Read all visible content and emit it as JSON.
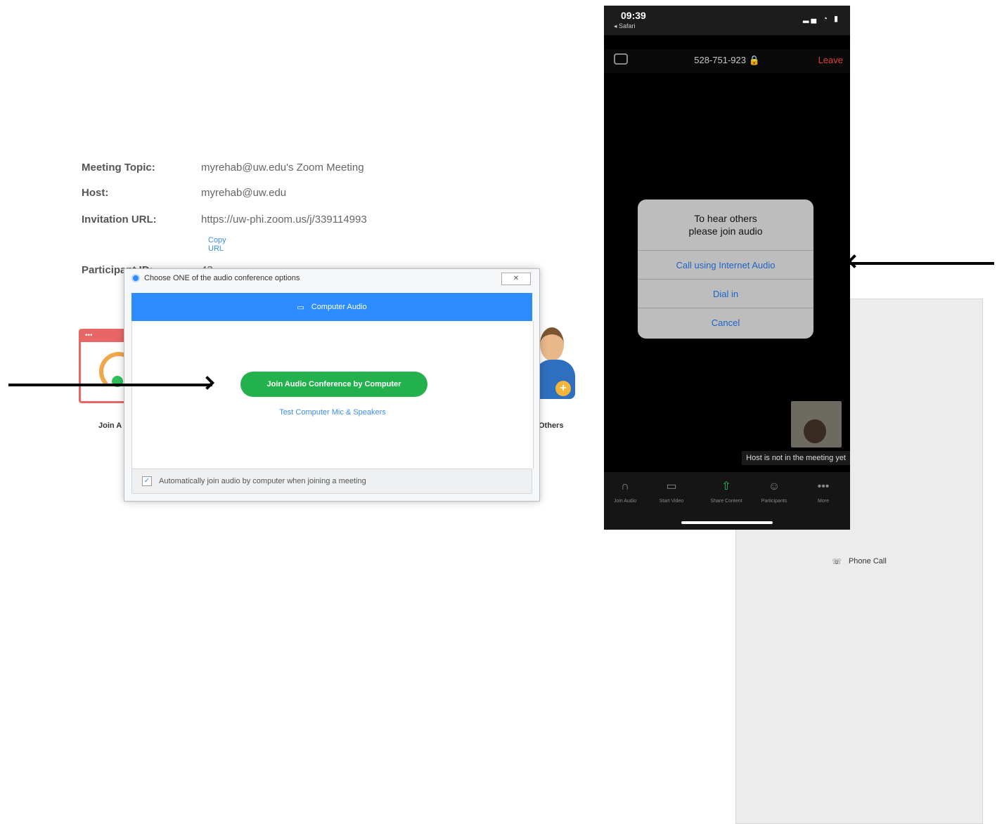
{
  "meeting_info": {
    "rows": [
      {
        "label": "Meeting Topic:",
        "value": "myrehab@uw.edu's Zoom Meeting"
      },
      {
        "label": "Host:",
        "value": "myrehab@uw.edu"
      },
      {
        "label": "Invitation URL:",
        "value": "https://uw-phi.zoom.us/j/339114993"
      }
    ],
    "copy_url": "Copy URL",
    "participant_label": "Participant ID:",
    "participant_value": "43"
  },
  "side_labels": {
    "left": "Join A",
    "right": "Others"
  },
  "desktop_dialog": {
    "title": "Choose ONE of the audio conference options",
    "close": "✕",
    "tabs": [
      {
        "label": "Phone Call",
        "icon": "phone-icon",
        "active": false
      },
      {
        "label": "Computer Audio",
        "icon": "laptop-icon",
        "active": true
      }
    ],
    "join_button": "Join Audio Conference by Computer",
    "test_link": "Test Computer Mic & Speakers",
    "auto_join": "Automatically join audio by computer when joining a meeting",
    "auto_join_checked": true
  },
  "phone": {
    "time": "09:39",
    "back_app": "◂ Safari",
    "meeting_id": "528-751-923 🔒",
    "leave": "Leave",
    "dialog": {
      "title_line1": "To hear others",
      "title_line2": "please join audio",
      "options": [
        "Call using Internet Audio",
        "Dial in",
        "Cancel"
      ]
    },
    "host_message": "Host is not in the meeting yet",
    "toolbar": [
      "Join Audio",
      "Start Video",
      "Share Content",
      "Participants",
      "More"
    ]
  },
  "colors": {
    "zoom_blue": "#2d8cff",
    "join_green": "#22b14c",
    "leave_red": "#e0413a"
  }
}
